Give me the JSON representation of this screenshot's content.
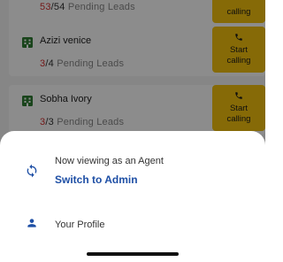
{
  "leads": [
    {
      "name": "",
      "done": "53",
      "sep": "/",
      "total": "54",
      "label": "Pending Leads",
      "call_label": "calling",
      "call_prefix": ""
    },
    {
      "name": "Azizi venice",
      "done": "3",
      "sep": "/",
      "total": "4",
      "label": "Pending Leads",
      "call_prefix": "Start",
      "call_label": "calling"
    },
    {
      "name": "Sobha Ivory",
      "done": "3",
      "sep": "/",
      "total": "3",
      "label": "Pending Leads",
      "call_prefix": "Start",
      "call_label": "calling"
    }
  ],
  "sheet": {
    "viewing_text": "Now viewing as an Agent",
    "switch_label": "Switch to Admin",
    "profile_label": "Your Profile"
  },
  "colors": {
    "accent_blue": "#1e4fa5",
    "call_yellow": "#f4c20d",
    "done_red": "#d32f2f",
    "building_green": "#2e7d32"
  },
  "icons": {
    "building": "building-icon",
    "phone": "phone-icon",
    "sync": "sync-icon",
    "person": "person-icon"
  }
}
